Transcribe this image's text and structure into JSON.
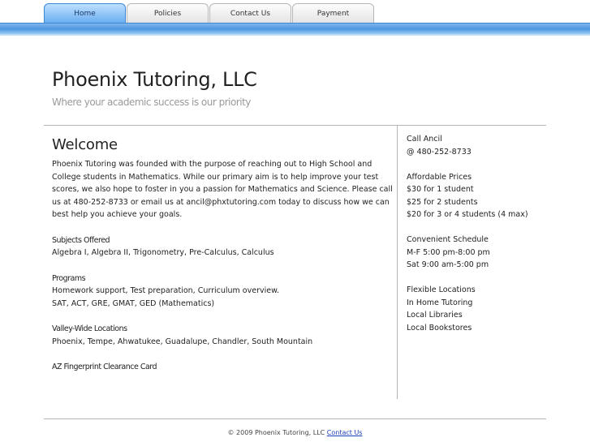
{
  "nav": {
    "tabs": [
      {
        "label": "Home",
        "active": true
      },
      {
        "label": "Policies",
        "active": false
      },
      {
        "label": "Contact Us",
        "active": false
      },
      {
        "label": "Payment",
        "active": false
      }
    ],
    "accent_color": "#4d97e0"
  },
  "header": {
    "title": "Phoenix Tutoring, LLC",
    "tagline": "Where your academic success is our priority"
  },
  "main": {
    "heading": "Welcome",
    "intro": "Phoenix Tutoring was founded with the purpose of reaching out to High School and College students in Mathematics. While our primary aim is to help improve your test scores, we also hope to foster in you a passion for Mathematics and Science. Please call us at 480-252-8733 or email us at ancil@phxtutoring.com today to discuss how we can best help you achieve your goals.",
    "sections": [
      {
        "title": "Subjects Offered",
        "lines": [
          "Algebra I, Algebra II, Trigonometry, Pre-Calculus, Calculus"
        ]
      },
      {
        "title": "Programs",
        "lines": [
          "Homework support, Test preparation, Curriculum overview.",
          "SAT, ACT, GRE, GMAT, GED (Mathematics)"
        ]
      },
      {
        "title": "Valley-Wide Locations",
        "lines": [
          "Phoenix, Tempe, Ahwatukee, Guadalupe, Chandler, South Mountain"
        ]
      },
      {
        "title": "AZ Fingerprint Clearance Card",
        "lines": []
      }
    ]
  },
  "sidebar": {
    "call": {
      "lines": [
        "Call Ancil",
        "@ 480-252-8733"
      ]
    },
    "prices": {
      "lines": [
        "Affordable Prices",
        "$30 for 1 student",
        "$25 for 2 students",
        "$20 for 3 or 4 students (4 max)"
      ]
    },
    "schedule": {
      "lines": [
        "Convenient Schedule",
        "M-F 5:00 pm-8:00 pm",
        "Sat 9:00 am-5:00 pm"
      ]
    },
    "locations": {
      "lines": [
        "Flexible Locations",
        "In Home Tutoring",
        "Local Libraries",
        "Local Bookstores"
      ]
    }
  },
  "footer": {
    "copyright": "© 2009 Phoenix Tutoring, LLC",
    "link_label": "Contact Us"
  }
}
